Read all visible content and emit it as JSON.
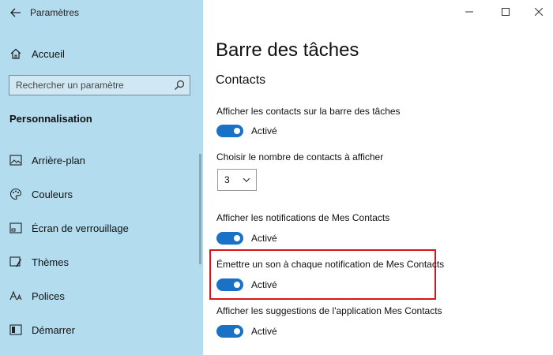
{
  "window": {
    "title": "Paramètres"
  },
  "sidebar": {
    "home_label": "Accueil",
    "search_placeholder": "Rechercher un paramètre",
    "section_title": "Personnalisation",
    "items": [
      {
        "label": "Arrière-plan",
        "icon": "image-icon"
      },
      {
        "label": "Couleurs",
        "icon": "palette-icon"
      },
      {
        "label": "Écran de verrouillage",
        "icon": "lock-screen-icon"
      },
      {
        "label": "Thèmes",
        "icon": "themes-icon"
      },
      {
        "label": "Polices",
        "icon": "fonts-icon"
      },
      {
        "label": "Démarrer",
        "icon": "start-icon"
      }
    ]
  },
  "main": {
    "page_title": "Barre des tâches",
    "subhead": "Contacts",
    "settings": [
      {
        "label": "Afficher les contacts sur la barre des tâches",
        "state": "Activé"
      },
      {
        "label": "Choisir le nombre de contacts à afficher",
        "value": "3"
      },
      {
        "label": "Afficher les notifications de Mes Contacts",
        "state": "Activé"
      },
      {
        "label": "Émettre un son à chaque notification de Mes Contacts",
        "state": "Activé"
      },
      {
        "label": "Afficher les suggestions de l'application Mes Contacts",
        "state": "Activé"
      }
    ]
  },
  "colors": {
    "sidebar_bg": "#b3dcef",
    "toggle_on": "#1a72c6",
    "highlight": "#d9141a"
  }
}
